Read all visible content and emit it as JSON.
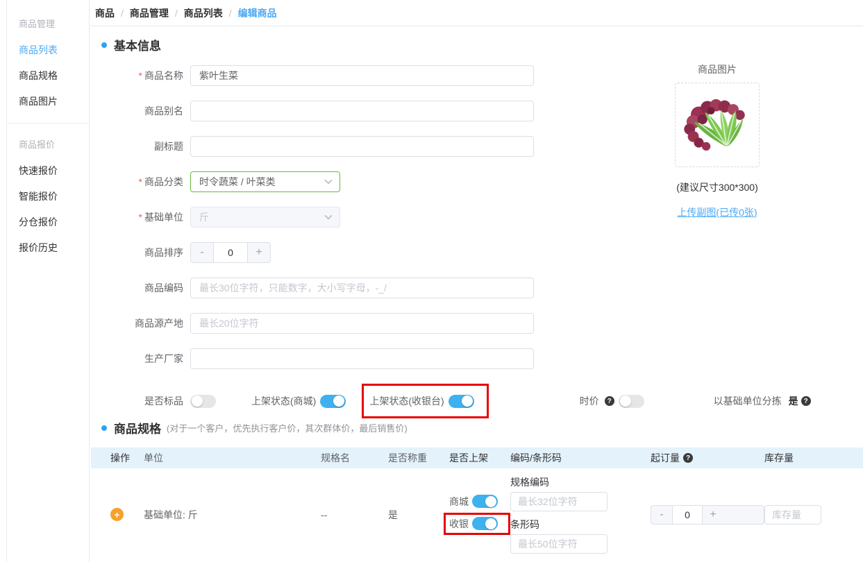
{
  "misc": {
    "required_mark": "*",
    "help_glyph": "?",
    "minus": "-",
    "plus": "+"
  },
  "colors": {
    "accent_blue": "#4ba9f5",
    "toggle_on_blue": "#3eb1f0",
    "highlight_red": "#e60000",
    "table_header_bg": "#e4f2fb",
    "add_button_orange": "#f7a02b",
    "category_border_green": "#63bb3c"
  },
  "sidebar": {
    "groups": [
      {
        "header": "商品管理",
        "items": [
          {
            "label": "商品列表"
          },
          {
            "label": "商品规格"
          },
          {
            "label": "商品图片"
          }
        ]
      },
      {
        "header": "商品报价",
        "items": [
          {
            "label": "快速报价"
          },
          {
            "label": "智能报价"
          },
          {
            "label": "分仓报价"
          },
          {
            "label": "报价历史"
          }
        ]
      }
    ]
  },
  "breadcrumb": {
    "separator": "/",
    "items": [
      "商品",
      "商品管理",
      "商品列表"
    ],
    "current": "编辑商品"
  },
  "basic": {
    "title": "基本信息",
    "name_label": "商品名称",
    "name_value": "紫叶生菜",
    "alias_label": "商品别名",
    "subtitle_label": "副标题",
    "category_label": "商品分类",
    "category_value": "时令蔬菜 / 叶菜类",
    "unit_label": "基础单位",
    "unit_value": "斤",
    "sort_label": "商品排序",
    "sort_value": "0",
    "code_label": "商品编码",
    "code_placeholder": "最长30位字符，只能数字，大小写字母，-_/",
    "origin_label": "商品源产地",
    "origin_placeholder": "最长20位字符",
    "maker_label": "生产厂家",
    "standard_label": "是否标品",
    "mall_label": "上架状态(商城)",
    "cashier_label": "上架状态(收银台)",
    "timeprice_label": "时价",
    "sorting_label": "以基础单位分拣",
    "sorting_value": "是"
  },
  "image_panel": {
    "title": "商品图片",
    "hint": "(建议尺寸300*300)",
    "upload_link": "上传副图(已传0张)"
  },
  "spec": {
    "title": "商品规格",
    "note": "(对于一个客户，优先执行客户价，其次群体价，最后销售价)",
    "columns": [
      "操作",
      "单位",
      "规格名",
      "是否称重",
      "是否上架",
      "编码/条形码",
      "起订量",
      "库存量"
    ],
    "row": {
      "unit": "基础单位: 斤",
      "spec_name": "--",
      "weigh": "是",
      "mall_label": "商城",
      "cashier_label": "收银",
      "spec_code_label": "规格编码",
      "spec_code_placeholder": "最长32位字符",
      "barcode_label": "条形码",
      "barcode_placeholder": "最长50位字符",
      "min_order_value": "0",
      "stock_placeholder": "库存量"
    }
  }
}
